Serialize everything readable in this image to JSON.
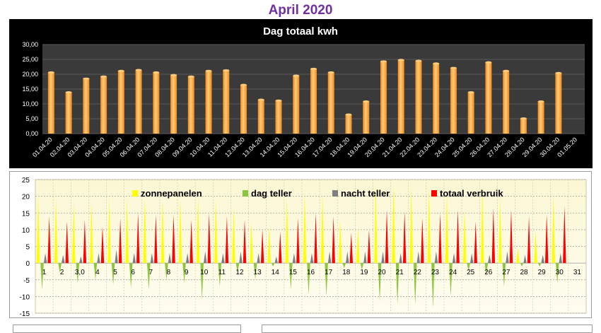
{
  "page_title": "April 2020",
  "chart_data": [
    {
      "type": "bar",
      "title": "Dag totaal kwh",
      "categories": [
        "01.04.20",
        "02.04.20",
        "03.04.20",
        "04.04.20",
        "05.04.20",
        "06.04.20",
        "07.04.20",
        "08.04.20",
        "09.04.20",
        "10.04.20",
        "11.04.20",
        "12.04.20",
        "13.04.20",
        "14.04.20",
        "15.04.20",
        "16.04.20",
        "17.04.20",
        "18.04.20",
        "19.04.20",
        "20.04.20",
        "21.04.20",
        "22.04.20",
        "23.04.20",
        "24.04.20",
        "25.04.20",
        "26.04.20",
        "27.04.20",
        "28.04.20",
        "29.04.20",
        "30.04.20",
        "01.05.20"
      ],
      "values": [
        20.6,
        13.9,
        18.5,
        19.2,
        21.1,
        21.4,
        20.6,
        19.7,
        19.2,
        21.1,
        21.3,
        16.4,
        11.4,
        11.1,
        19.5,
        21.8,
        20.6,
        6.4,
        10.8,
        24.3,
        24.8,
        24.5,
        23.6,
        22.1,
        13.9,
        24.0,
        21.1,
        5.1,
        10.8,
        20.4,
        0
      ],
      "ylim": [
        0,
        30
      ],
      "yticks": [
        "0,00",
        "5,00",
        "10,00",
        "15,00",
        "20,00",
        "25,00",
        "30,00"
      ],
      "grid": true,
      "colors": {
        "bar": "#f08a1c",
        "bar_highlight": "#ffcb7a",
        "plot_bg": "#3a3a3a",
        "panel_bg": "#000000",
        "grid": "#5a5a5a",
        "text": "#ffffff"
      }
    },
    {
      "type": "area",
      "categories": [
        "1",
        "2",
        "3,0",
        "4",
        "5",
        "6",
        "7",
        "8",
        "9",
        "10",
        "11",
        "12",
        "13",
        "14",
        "15",
        "16",
        "17",
        "18",
        "19",
        "20",
        "21",
        "22",
        "23",
        "24",
        "25",
        "26",
        "27",
        "28",
        "29",
        "30",
        "31"
      ],
      "ylim": [
        -15,
        25
      ],
      "yticks": [
        "-15",
        "-10",
        "-5",
        "0",
        "5",
        "10",
        "15",
        "20",
        "25"
      ],
      "legend": "top",
      "grid": true,
      "series": [
        {
          "name": "zonnepanelen",
          "color": "#ffff00",
          "values": [
            20,
            19,
            17.5,
            18,
            19.5,
            19.5,
            19.5,
            19,
            19,
            19.5,
            19,
            17,
            12.5,
            11,
            19.5,
            21,
            20.5,
            13,
            10.5,
            23.5,
            24,
            23,
            22.5,
            21,
            16,
            22.5,
            19.5,
            4.5,
            9.5,
            20,
            0
          ]
        },
        {
          "name": "dag teller",
          "color": "#8cc63f",
          "values": [
            -8,
            -3,
            -6,
            -5,
            -6.5,
            -7.5,
            -8,
            -5,
            -6,
            -11,
            -7,
            -3,
            -5,
            -1,
            -8,
            -9.5,
            -10,
            -1.5,
            -2,
            -11.5,
            -12.5,
            -12.5,
            -13.5,
            -10,
            -2.5,
            -4,
            -7,
            -1,
            -1,
            -6,
            0
          ]
        },
        {
          "name": "nacht teller",
          "color": "#7f7f7f",
          "values": [
            3,
            2.5,
            2,
            3,
            4,
            3,
            3,
            3,
            3,
            3.5,
            3,
            3.5,
            3,
            2,
            3,
            3,
            3.5,
            3.5,
            3.5,
            3.5,
            3,
            3.5,
            3.5,
            3,
            3,
            2.5,
            3.5,
            2.5,
            2.5,
            3,
            0
          ]
        },
        {
          "name": "totaal verbruik",
          "color": "#ff0000",
          "values": [
            14,
            12.5,
            13,
            11,
            13.5,
            15,
            14.5,
            14.5,
            13,
            15,
            14,
            13,
            10,
            9.5,
            13.5,
            15,
            14,
            9,
            10,
            16,
            15.5,
            13.5,
            15,
            16,
            12.5,
            16.5,
            16,
            14,
            14.5,
            17,
            0
          ]
        }
      ],
      "colors": {
        "plot_bg": "#fdfbe3",
        "grid": "#9a9a9a",
        "axis_text": "#000000"
      }
    }
  ],
  "bottom_panels": [
    {},
    {}
  ]
}
